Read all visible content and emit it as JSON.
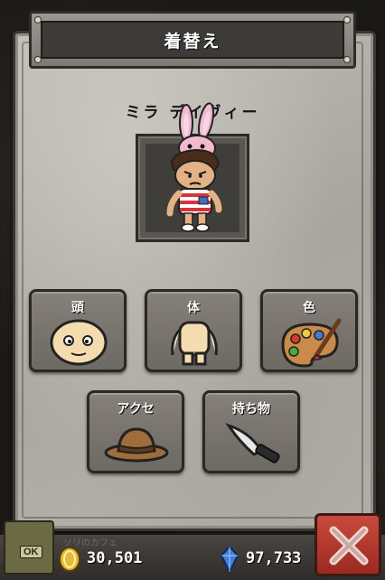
{
  "header": {
    "title": "着替え"
  },
  "character": {
    "name": "ミラ デイヴィー"
  },
  "categories": [
    {
      "id": "head",
      "label": "頭",
      "icon": "head-icon"
    },
    {
      "id": "body",
      "label": "体",
      "icon": "body-icon"
    },
    {
      "id": "color",
      "label": "色",
      "icon": "palette-icon"
    },
    {
      "id": "accessory",
      "label": "アクセ",
      "icon": "hat-icon"
    },
    {
      "id": "item",
      "label": "持ち物",
      "icon": "knife-icon"
    }
  ],
  "footer": {
    "ok_label": "OK",
    "shop_name": "ソリのカフェ",
    "coins": "30,501",
    "gems": "97,733"
  },
  "colors": {
    "panel": "#b4b1ab",
    "button": "#77736d",
    "close": "#b8392e"
  }
}
